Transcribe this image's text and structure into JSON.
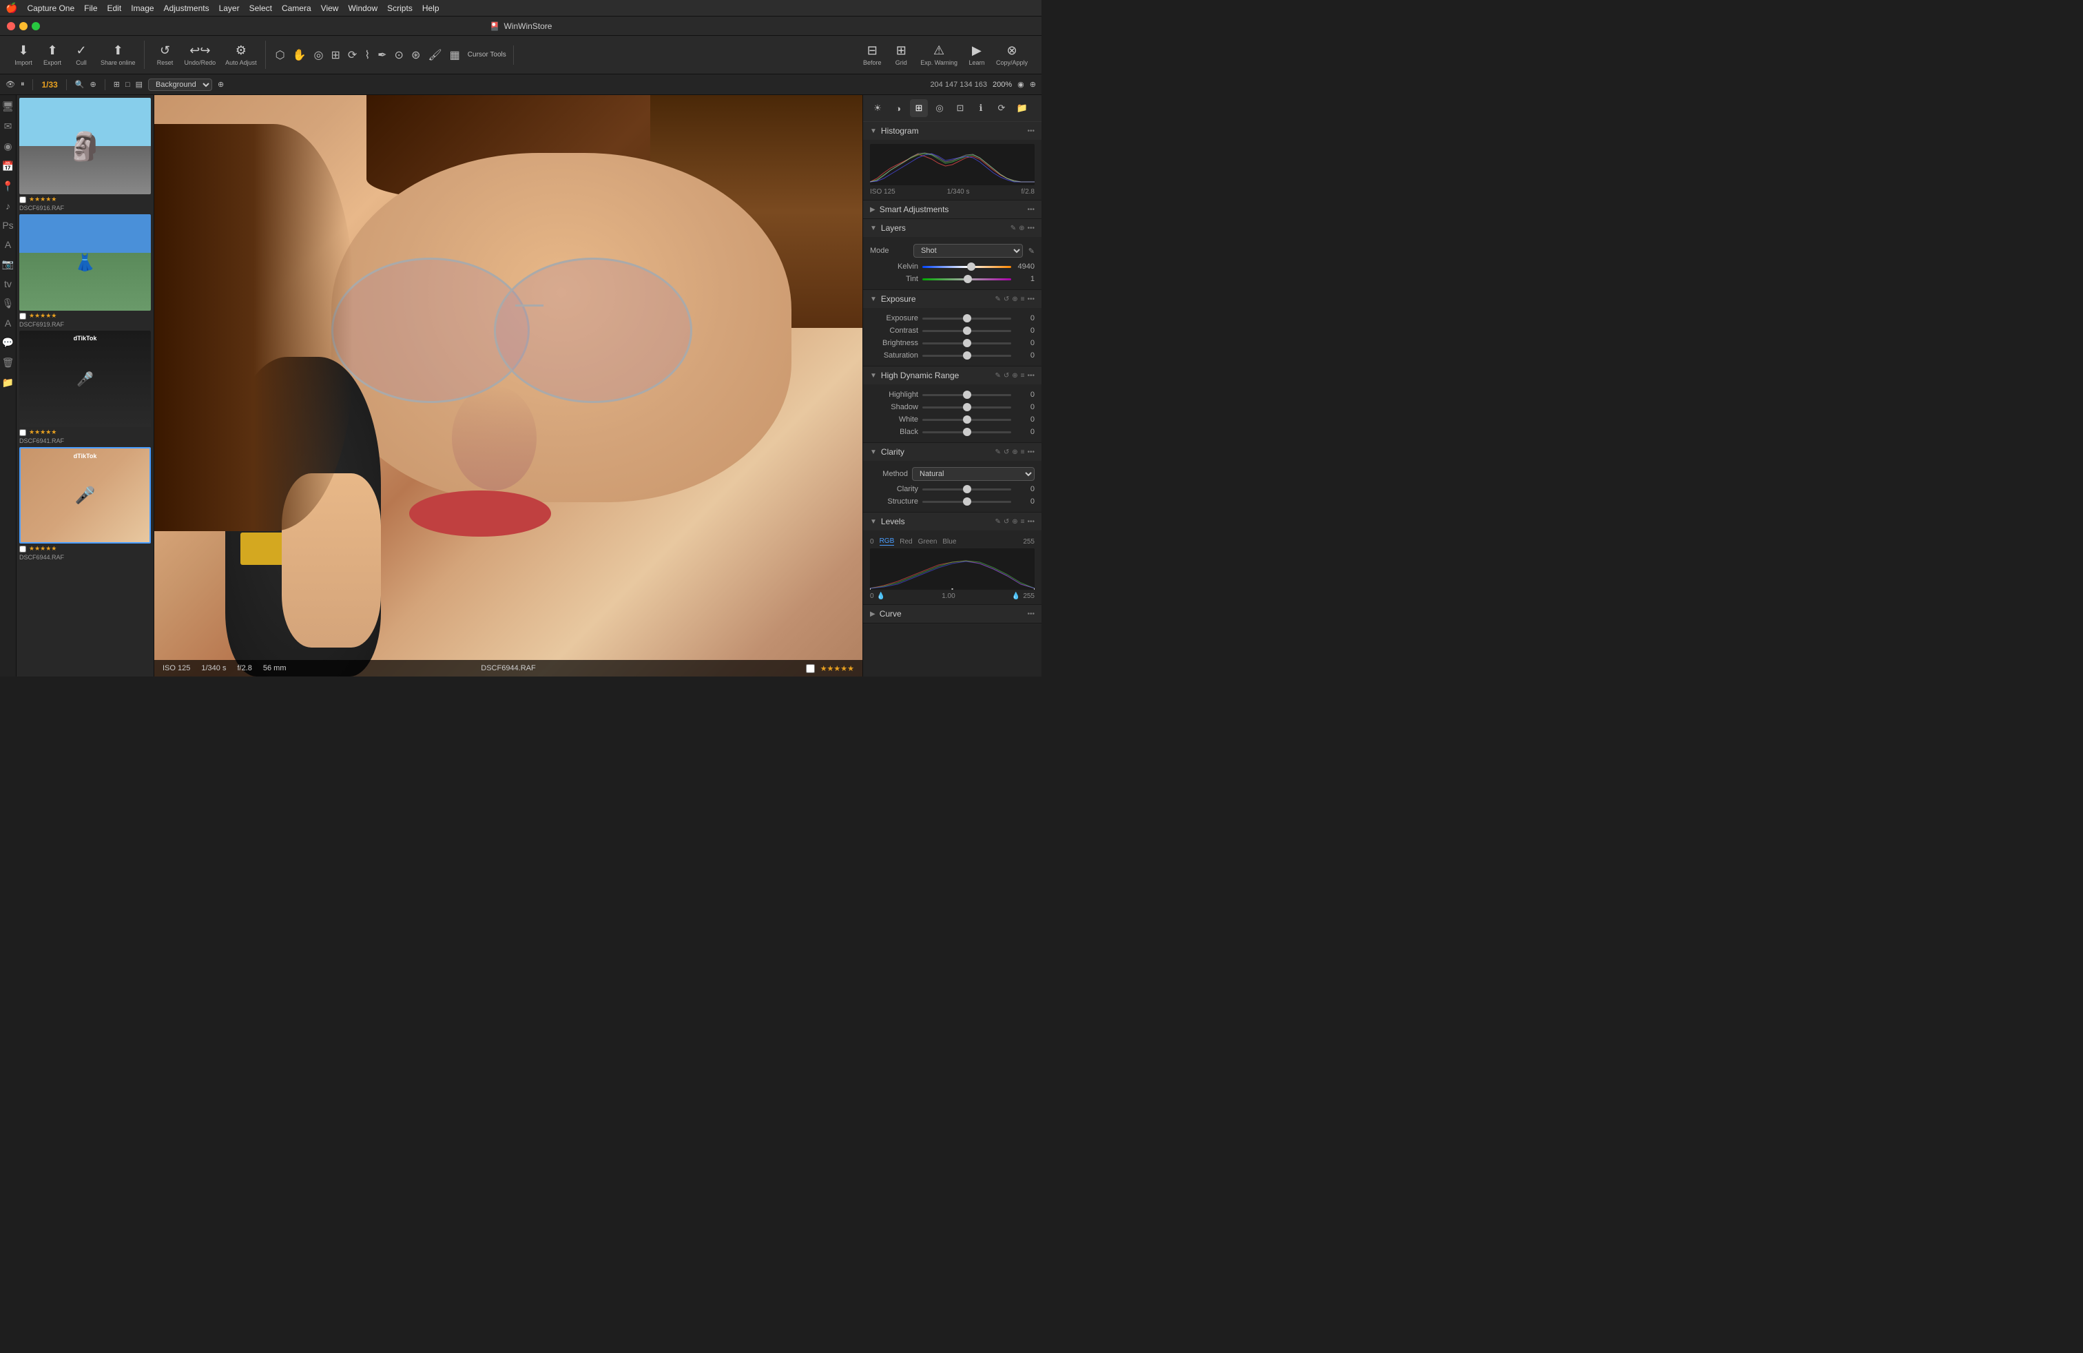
{
  "app": {
    "name": "Capture One",
    "title": "WinWinStore",
    "icon": "🎴"
  },
  "menubar": {
    "apple": "🍎",
    "items": [
      "Capture One",
      "File",
      "Edit",
      "Image",
      "Adjustments",
      "Layer",
      "Select",
      "Camera",
      "View",
      "Window",
      "Scripts",
      "Help"
    ]
  },
  "traffic_lights": {
    "close": "close",
    "minimize": "minimize",
    "maximize": "maximize"
  },
  "toolbar": {
    "import_label": "Import",
    "export_label": "Export",
    "cull_label": "Cull",
    "share_online_label": "Share online",
    "reset_label": "Reset",
    "undo_redo_label": "Undo/Redo",
    "auto_adjust_label": "Auto Adjust",
    "cursor_tools_label": "Cursor Tools",
    "before_label": "Before",
    "grid_label": "Grid",
    "exp_warning_label": "Exp. Warning",
    "learn_label": "Learn",
    "copy_apply_label": "Copy/Apply"
  },
  "toolbar2": {
    "counter": "1/33",
    "bg_label": "Background",
    "coords": "204  147  134  163",
    "zoom": "200%"
  },
  "filmstrip": {
    "items": [
      {
        "name": "DSCF6916.RAF",
        "stars": "★★★★★",
        "type": "statue",
        "selected": false
      },
      {
        "name": "DSCF6919.RAF",
        "stars": "★★★★★",
        "type": "girls",
        "selected": false
      },
      {
        "name": "DSCF6941.RAF",
        "stars": "★★★★★",
        "type": "tiktok1",
        "selected": false
      },
      {
        "name": "DSCF6944.RAF",
        "stars": "★★★★★",
        "type": "tiktok2",
        "selected": true
      }
    ]
  },
  "photo": {
    "filename": "DSCF6944.RAF",
    "iso": "ISO 125",
    "shutter": "1/340 s",
    "aperture": "f/2.8",
    "focal_length": "56 mm",
    "stars": "★★★★★"
  },
  "right_panel": {
    "histogram": {
      "title": "Histogram",
      "iso": "ISO 125",
      "shutter": "1/340 s",
      "aperture": "f/2.8"
    },
    "smart_adjustments": {
      "title": "Smart Adjustments"
    },
    "layers": {
      "title": "Layers",
      "mode_label": "Mode",
      "mode_value": "Shot",
      "kelvin_label": "Kelvin",
      "kelvin_value": "4940",
      "tint_label": "Tint",
      "tint_value": "1"
    },
    "exposure": {
      "title": "Exposure",
      "exposure_label": "Exposure",
      "exposure_value": "0",
      "contrast_label": "Contrast",
      "contrast_value": "0",
      "brightness_label": "Brightness",
      "brightness_value": "0",
      "saturation_label": "Saturation",
      "saturation_value": "0"
    },
    "hdr": {
      "title": "High Dynamic Range",
      "highlight_label": "Highlight",
      "highlight_value": "0",
      "shadow_label": "Shadow",
      "shadow_value": "0",
      "white_label": "White",
      "white_value": "0",
      "black_label": "Black",
      "black_value": "0"
    },
    "clarity": {
      "title": "Clarity",
      "method_label": "Method",
      "method_value": "Natural",
      "clarity_label": "Clarity",
      "clarity_value": "0",
      "structure_label": "Structure",
      "structure_value": "0"
    },
    "levels": {
      "title": "Levels",
      "tab_rgb": "RGB",
      "tab_red": "Red",
      "tab_green": "Green",
      "tab_blue": "Blue",
      "val_left": "0",
      "val_center": "1.00",
      "val_right": "255",
      "active_tab": "RGB"
    },
    "curve": {
      "title": "Curve"
    }
  }
}
